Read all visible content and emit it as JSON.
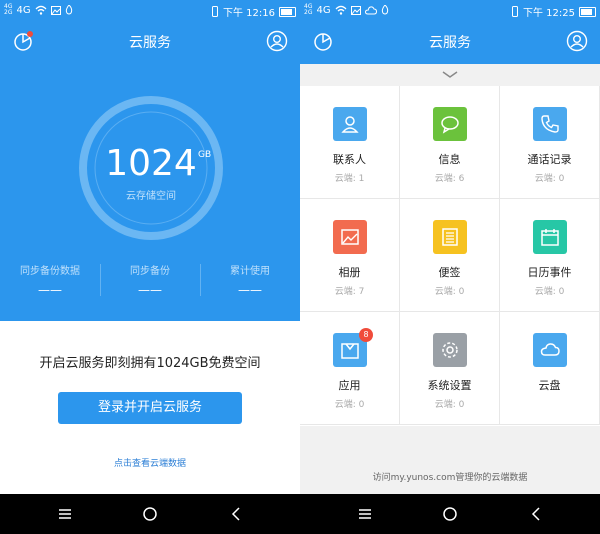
{
  "left": {
    "status": {
      "signal1": "4G",
      "signal2": "2G",
      "network": "4G",
      "time": "下午 12:16"
    },
    "title": "云服务",
    "storage": {
      "amount": "1024",
      "unit": "GB",
      "label": "云存储空间"
    },
    "stats": [
      {
        "label": "同步备份数据",
        "value": "——"
      },
      {
        "label": "同步备份",
        "value": "——"
      },
      {
        "label": "累计使用",
        "value": "——"
      }
    ],
    "promo": "开启云服务即刻拥有1024GB免费空间",
    "login_button": "登录并开启云服务",
    "view_link": "点击查看云端数据"
  },
  "right": {
    "status": {
      "signal1": "4G",
      "signal2": "2G",
      "network": "4G",
      "time": "下午 12:25"
    },
    "title": "云服务",
    "items": [
      {
        "label": "联系人",
        "count": "云端: 1",
        "color": "#4aa8ee",
        "icon": "contacts-icon"
      },
      {
        "label": "信息",
        "count": "云端: 6",
        "color": "#6bc23c",
        "icon": "message-icon"
      },
      {
        "label": "通话记录",
        "count": "云端: 0",
        "color": "#4aa8ee",
        "icon": "phone-icon"
      },
      {
        "label": "相册",
        "count": "云端: 7",
        "color": "#f26b4f",
        "icon": "photo-icon"
      },
      {
        "label": "便签",
        "count": "云端: 0",
        "color": "#f6c220",
        "icon": "note-icon"
      },
      {
        "label": "日历事件",
        "count": "云端: 0",
        "color": "#27c7a6",
        "icon": "calendar-icon"
      },
      {
        "label": "应用",
        "count": "云端: 0",
        "color": "#4aa8ee",
        "icon": "app-icon",
        "badge": "8"
      },
      {
        "label": "系统设置",
        "count": "云端: 0",
        "color": "#9aa0a6",
        "icon": "gear-icon"
      },
      {
        "label": "云盘",
        "count": "",
        "color": "#4aa8ee",
        "icon": "cloud-icon"
      }
    ],
    "footer": "访问my.yunos.com管理你的云端数据"
  }
}
